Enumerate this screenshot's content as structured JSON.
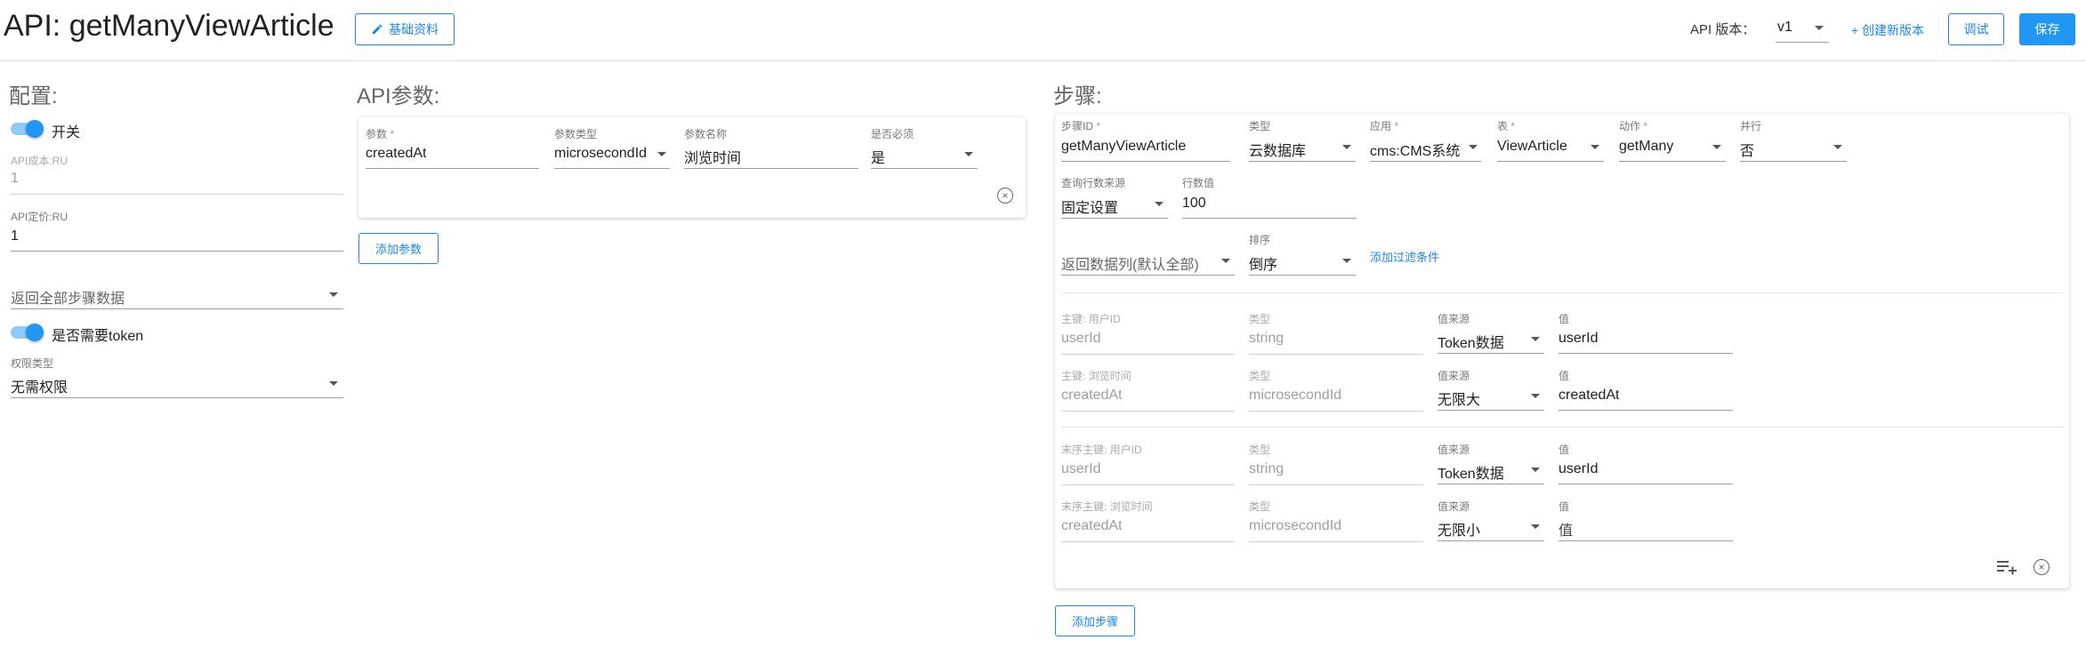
{
  "header": {
    "title": "API: getManyViewArticle",
    "basic_info_label": "基础资料",
    "version_label": "API 版本：",
    "version_value": "v1",
    "create_version_label": "+ 创建新版本",
    "debug_label": "调试",
    "save_label": "保存"
  },
  "config": {
    "title": "配置:",
    "switch_label": "开关",
    "switch_on": true,
    "api_cost_label": "API成本:RU",
    "api_cost_value": "1",
    "api_price_label": "API定价:RU",
    "api_price_value": "1",
    "return_steps_value": "返回全部步骤数据",
    "need_token_label": "是否需要token",
    "need_token_on": true,
    "permission_label": "权限类型",
    "permission_value": "无需权限"
  },
  "params": {
    "title": "API参数:",
    "param_label": "参数",
    "param_value": "createdAt",
    "type_label": "参数类型",
    "type_value": "microsecondId",
    "name_label": "参数名称",
    "name_value": "浏览时间",
    "required_label": "是否必须",
    "required_value": "是",
    "add_label": "添加参数"
  },
  "steps": {
    "title": "步骤:",
    "step_id_label": "步骤ID",
    "step_id_value": "getManyViewArticle",
    "kind_label": "类型",
    "kind_value": "云数据库",
    "app_label": "应用",
    "app_value": "cms:CMS系统",
    "table_label": "表",
    "table_value": "ViewArticle",
    "action_label": "动作",
    "action_value": "getMany",
    "parallel_label": "并行",
    "parallel_value": "否",
    "row_source_label": "查询行数来源",
    "row_source_value": "固定设置",
    "row_count_label": "行数值",
    "row_count_value": "100",
    "return_cols_value": "返回数据列(默认全部)",
    "sort_label": "排序",
    "sort_value": "倒序",
    "add_filter_label": "添加过滤条件",
    "keys": [
      {
        "key_label": "主键: 用户ID",
        "key_value": "userId",
        "type_label": "类型",
        "type_value": "string",
        "source_label": "值来源",
        "source_value": "Token数据",
        "value_label": "值",
        "value_value": "userId"
      },
      {
        "key_label": "主键: 浏览时间",
        "key_value": "createdAt",
        "type_label": "类型",
        "type_value": "microsecondId",
        "source_label": "值来源",
        "source_value": "无限大",
        "value_label": "值",
        "value_value": "createdAt"
      },
      {
        "key_label": "末序主键: 用户ID",
        "key_value": "userId",
        "type_label": "类型",
        "type_value": "string",
        "source_label": "值来源",
        "source_value": "Token数据",
        "value_label": "值",
        "value_value": "userId"
      },
      {
        "key_label": "末序主键: 浏览时间",
        "key_value": "createdAt",
        "type_label": "类型",
        "type_value": "microsecondId",
        "source_label": "值来源",
        "source_value": "无限小",
        "value_label": "值",
        "value_value": ""
      }
    ],
    "value_placeholder": "值",
    "add_step_label": "添加步骤"
  },
  "colors": {
    "accent": "#2196f3",
    "accent_light": "#90caf9"
  },
  "icons": {
    "edit": "pencil-icon",
    "close": "close-circle-icon",
    "add_row": "playlist-add-icon",
    "dropdown": "caret-down-icon"
  }
}
